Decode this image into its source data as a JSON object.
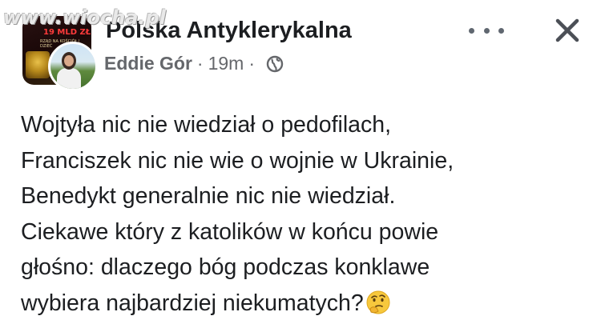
{
  "watermark": "www.wiocha.pl",
  "group_avatar": {
    "title_text": "19 MLD ZŁ",
    "subtitle_text": "RZĄD NA KOŚCIÓŁ | DZIEĆ"
  },
  "header": {
    "group_name": "Polska Antyklerykalna",
    "author": "Eddie Gór",
    "separator": "·",
    "time": "19m",
    "separator_2": "·",
    "privacy_icon": "globe-icon",
    "more_icon": "more-dots-icon",
    "close_icon": "close-icon"
  },
  "post": {
    "lines": [
      "Wojtyła nic nie wiedział o pedofilach,",
      "Franciszek nic nie wie o wojnie w Ukrainie,",
      "Benedykt generalnie nic nie wiedział.",
      "Ciekawe który z katolików w końcu powie",
      "głośno: dlaczego bóg podczas konklawe",
      "wybiera najbardziej niekumatych?"
    ],
    "trailing_emoji": "thinking-face-icon"
  },
  "colors": {
    "text_primary": "#1c1e21",
    "text_secondary": "#65676b",
    "icon_gray": "#606770",
    "background": "#ffffff"
  }
}
